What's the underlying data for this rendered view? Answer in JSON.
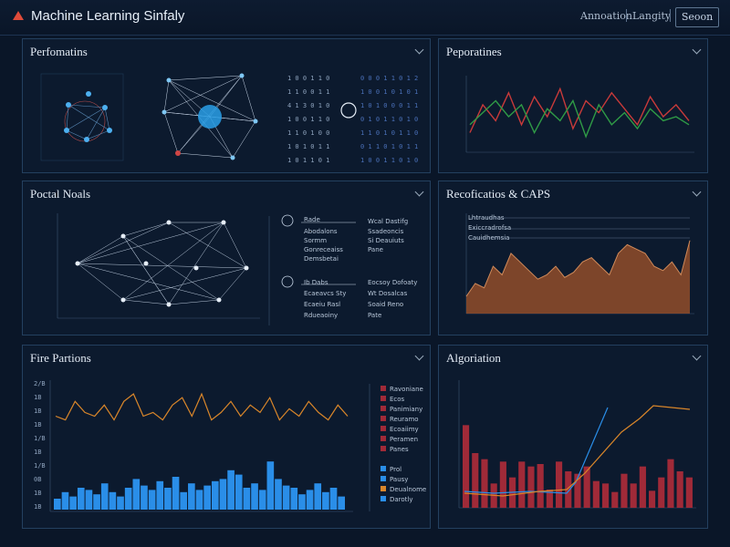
{
  "header": {
    "title": "Machine Learning Sinfaly",
    "nav": [
      "Annoation",
      "Langity",
      "Seoon"
    ]
  },
  "panels": {
    "performance_left": {
      "title": "Perfomatins"
    },
    "performance_right": {
      "title": "Peporatines"
    },
    "neural": {
      "title": "Poctal Noals"
    },
    "rectification": {
      "title": "Recoficatios & CAPS"
    },
    "fire": {
      "title": "Fire Partions"
    },
    "algorithm": {
      "title": "Algoriation"
    }
  },
  "colors": {
    "accent_blue": "#2a8ee8",
    "accent_orange": "#d9862a",
    "accent_red": "#a02a38",
    "line_green": "#2f9a46",
    "line_red": "#c83a3a",
    "area_brown": "#8a4a2a"
  },
  "chart_data": [
    {
      "type": "line",
      "panel": "performance_right",
      "series": [
        {
          "values": [
            20,
            55,
            35,
            70,
            30,
            65,
            40,
            75,
            25,
            60,
            45,
            70,
            50,
            30,
            65,
            40,
            55,
            35
          ]
        },
        {
          "values": [
            30,
            45,
            60,
            40,
            55,
            20,
            50,
            35,
            60,
            15,
            55,
            30,
            45,
            25,
            50,
            35,
            40,
            30
          ]
        }
      ]
    },
    {
      "type": "area",
      "panel": "rectification",
      "values": [
        20,
        35,
        30,
        55,
        45,
        70,
        60,
        50,
        40,
        45,
        55,
        42,
        48,
        60,
        65,
        55,
        45,
        70,
        80,
        75,
        70,
        55,
        50,
        60,
        45,
        85
      ],
      "legend": [
        "Lhtraudhas",
        "Exiccradrofsa",
        "Cauidhemsia"
      ]
    },
    {
      "type": "line",
      "panel": "fire",
      "values": [
        40,
        35,
        60,
        45,
        40,
        55,
        35,
        60,
        70,
        40,
        45,
        35,
        55,
        65,
        40,
        70,
        35,
        45,
        60,
        40,
        55,
        45,
        65,
        35,
        50,
        40,
        60,
        45,
        35,
        55,
        40
      ],
      "yticks": [
        "2/B",
        "1B",
        "1B",
        "1B",
        "1/B",
        "1B",
        "1/B",
        "0B",
        "1B",
        "1B"
      ]
    },
    {
      "type": "bar",
      "panel": "fire",
      "values": [
        5,
        8,
        6,
        10,
        9,
        7,
        12,
        8,
        6,
        10,
        14,
        11,
        9,
        13,
        10,
        15,
        8,
        12,
        9,
        11,
        13,
        14,
        18,
        16,
        10,
        12,
        9,
        22,
        14,
        11,
        10,
        7,
        9,
        12,
        8,
        10,
        6
      ],
      "legend": [
        "Ravoniane",
        "Ecos",
        "Panimiany",
        "Reuramo",
        "Ecoaiimy",
        "Peramen",
        "Panes",
        "Prol",
        "Pausy",
        "Deualnome",
        "Darotly"
      ]
    },
    {
      "type": "bar",
      "panel": "algorithm",
      "values": [
        68,
        45,
        40,
        20,
        38,
        25,
        38,
        34,
        36,
        15,
        38,
        30,
        28,
        34,
        22,
        20,
        13,
        28,
        20,
        34,
        14,
        25,
        40,
        30,
        25
      ]
    }
  ],
  "labels": {
    "perf_left_matrix_icon": "©",
    "neural_legend_a": [
      "Rade",
      "Abodalons",
      "Sormm",
      "Gonreceaiss",
      "Demsbetai"
    ],
    "neural_legend_b": [
      "Wcal Dastifg",
      "Ssadeoncis",
      "Si Deauiuts",
      "Pane"
    ],
    "neural_legend_c": [
      "Ib Dabs",
      "Ecaeavcs Sty",
      "Ecaeiu Rasl",
      "Rdueaoiny"
    ],
    "neural_legend_d": [
      "Eocsoy Dofoaty",
      "Wt Dosalcas",
      "Soaid Reno",
      "Pate"
    ]
  }
}
